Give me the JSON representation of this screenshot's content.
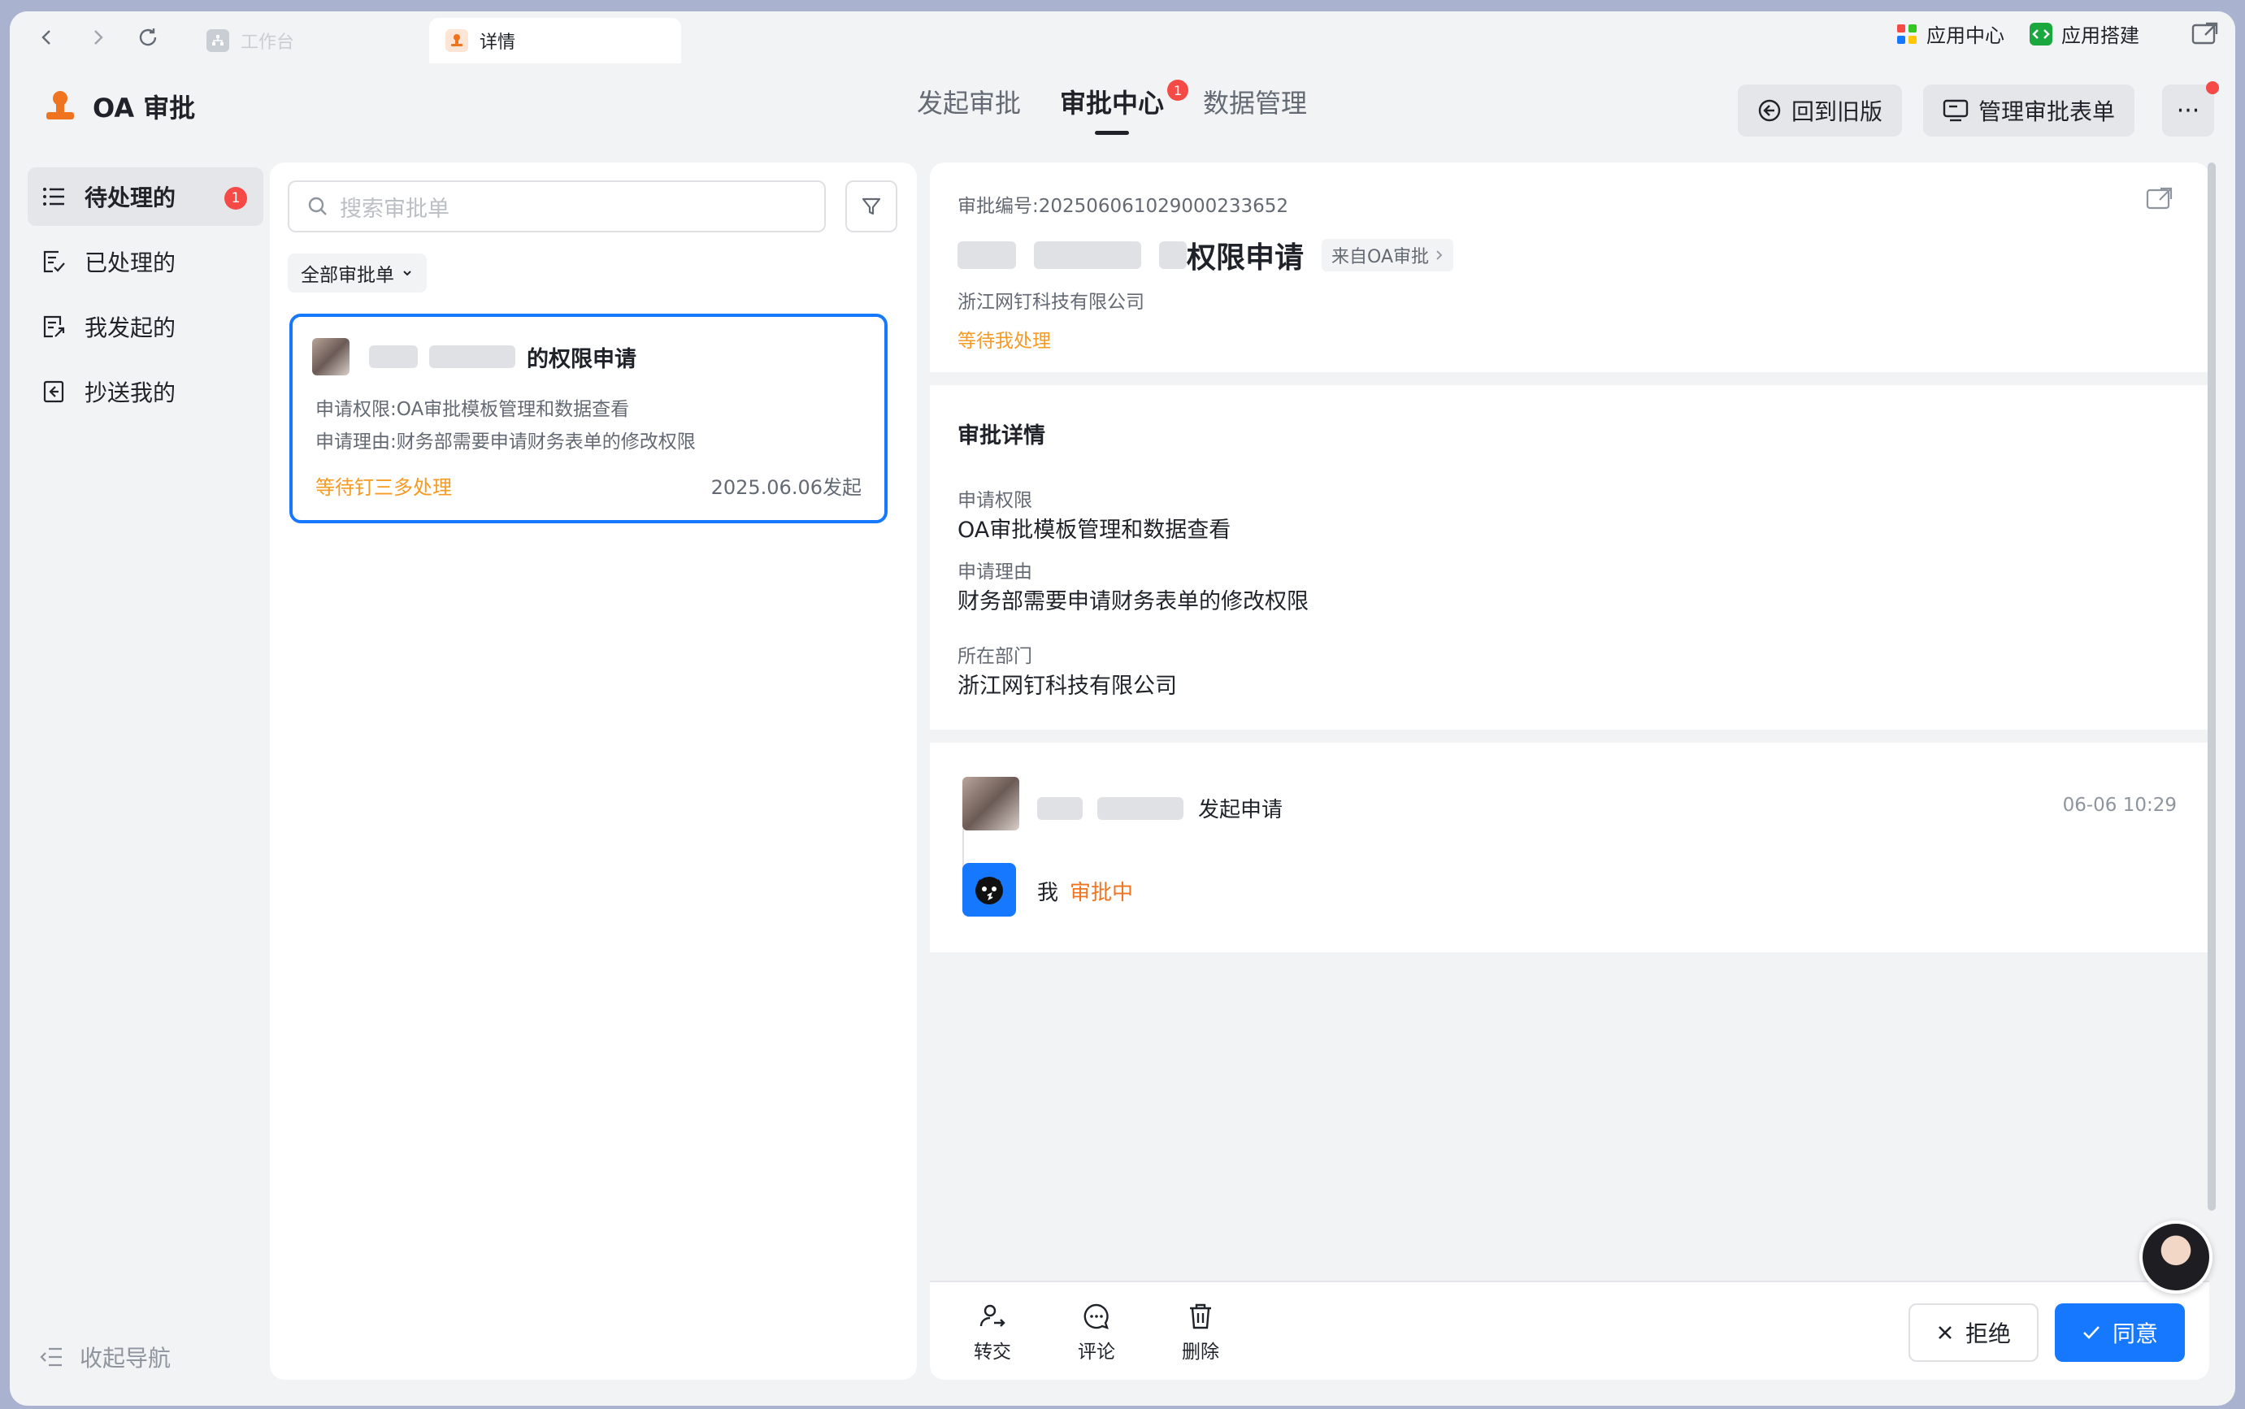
{
  "colors": {
    "accent": "#1677ff",
    "warning": "#f59a23",
    "badge": "#f54a45",
    "text": "#1f2329",
    "muted": "#646a73"
  },
  "browser": {
    "tabs": [
      {
        "label": "工作台",
        "icon": "workspace-icon",
        "active": false
      },
      {
        "label": "详情",
        "icon": "approval-stamp-icon",
        "active": true
      }
    ],
    "right_links": [
      {
        "label": "应用中心",
        "icon": "app-grid-icon"
      },
      {
        "label": "应用搭建",
        "icon": "code-box-icon"
      }
    ]
  },
  "header": {
    "app_name": "OA 审批",
    "nav": [
      {
        "label": "发起审批",
        "active": false
      },
      {
        "label": "审批中心",
        "active": true,
        "badge": "1"
      },
      {
        "label": "数据管理",
        "active": false
      }
    ],
    "back_old_label": "回到旧版",
    "manage_forms_label": "管理审批表单",
    "more_label": "···"
  },
  "sidebar": {
    "items": [
      {
        "label": "待处理的",
        "icon": "list-icon",
        "active": true,
        "badge": "1"
      },
      {
        "label": "已处理的",
        "icon": "doc-check-icon",
        "active": false
      },
      {
        "label": "我发起的",
        "icon": "doc-send-icon",
        "active": false
      },
      {
        "label": "抄送我的",
        "icon": "cc-icon",
        "active": false
      }
    ],
    "collapse_label": "收起导航"
  },
  "list": {
    "search_placeholder": "搜索审批单",
    "filter_label": "全部审批单",
    "card": {
      "title_suffix": "的权限申请",
      "line1": "申请权限:OA审批模板管理和数据查看",
      "line2": "申请理由:财务部需要申请财务表单的修改权限",
      "status": "等待钉三多处理",
      "date": "2025.06.06发起"
    }
  },
  "detail": {
    "number_label": "审批编号:",
    "number_value": "202506061029000233652",
    "title_suffix": "权限申请",
    "source_tag": "来自OA审批",
    "company": "浙江网钉科技有限公司",
    "status": "等待我处理",
    "section_title": "审批详情",
    "fields": [
      {
        "label": "申请权限",
        "value": "OA审批模板管理和数据查看"
      },
      {
        "label": "申请理由",
        "value": "财务部需要申请财务表单的修改权限"
      },
      {
        "label": "所在部门",
        "value": "浙江网钉科技有限公司"
      }
    ],
    "timeline": [
      {
        "action": "发起申请",
        "time": "06-06 10:29"
      },
      {
        "name": "我",
        "state": "审批中"
      }
    ],
    "actions": [
      {
        "label": "转交",
        "icon": "transfer-user-icon"
      },
      {
        "label": "评论",
        "icon": "comment-icon"
      },
      {
        "label": "删除",
        "icon": "trash-icon"
      }
    ],
    "reject_label": "拒绝",
    "agree_label": "同意"
  }
}
